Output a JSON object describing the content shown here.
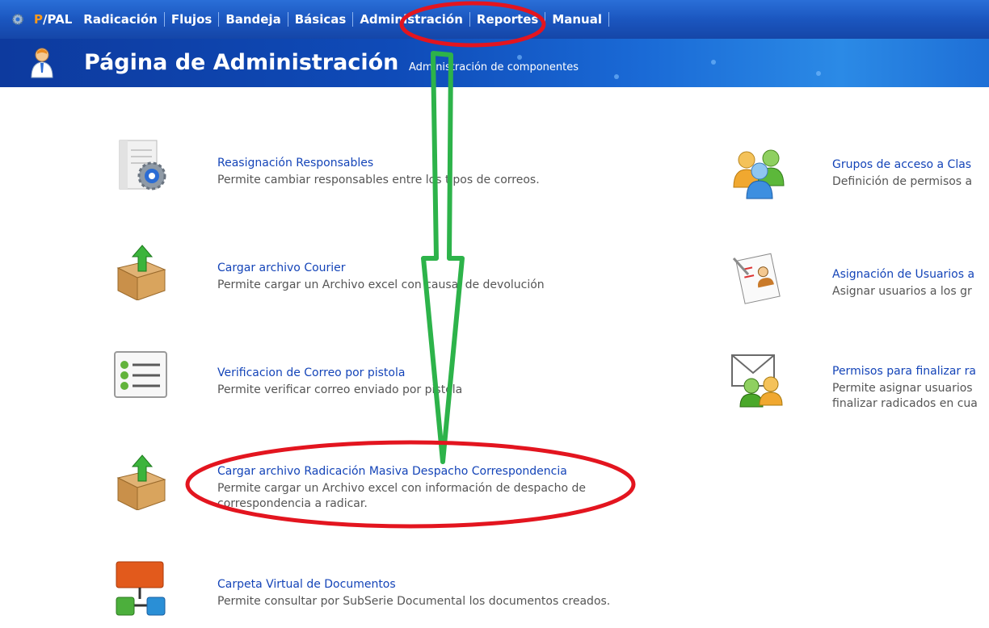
{
  "nav": {
    "brand_prefix": "P",
    "brand_suffix": "/PAL",
    "items": [
      "Radicación",
      "Flujos",
      "Bandeja",
      "Básicas",
      "Administración",
      "Reportes",
      "Manual"
    ]
  },
  "header": {
    "title": "Página de Administración",
    "subtitle": "Administración de componentes"
  },
  "left_items": [
    {
      "title": "Reasignación Responsables",
      "desc": "Permite cambiar responsables entre los tipos de correos.",
      "icon": "reassign-gear-icon"
    },
    {
      "title": "Cargar archivo Courier",
      "desc": "Permite cargar un Archivo excel con causal de devolución",
      "icon": "upload-box-icon"
    },
    {
      "title": "Verificacion de Correo por pistola",
      "desc": "Permite verificar correo enviado por pistola",
      "icon": "checklist-icon"
    },
    {
      "title": "Cargar archivo Radicación Masiva Despacho Correspondencia",
      "desc": "Permite cargar un Archivo excel con información de despacho de correspondencia a radicar.",
      "icon": "upload-box-icon"
    },
    {
      "title": "Carpeta Virtual de Documentos",
      "desc": "Permite consultar por SubSerie Documental los documentos creados.",
      "icon": "hierarchy-icon"
    }
  ],
  "right_items": [
    {
      "title": "Grupos de acceso a Clas",
      "desc": "Definición de permisos a",
      "icon": "user-group-icon"
    },
    {
      "title": "Asignación de Usuarios a",
      "desc": "Asignar usuarios a los gr",
      "icon": "assign-users-icon"
    },
    {
      "title": "Permisos para finalizar ra",
      "desc": "Permite asignar usuarios\nfinalizar radicados en cua",
      "icon": "mail-users-icon"
    }
  ],
  "annotation_colors": {
    "ellipse": "#e3151f",
    "arrow": "#2db34a"
  }
}
